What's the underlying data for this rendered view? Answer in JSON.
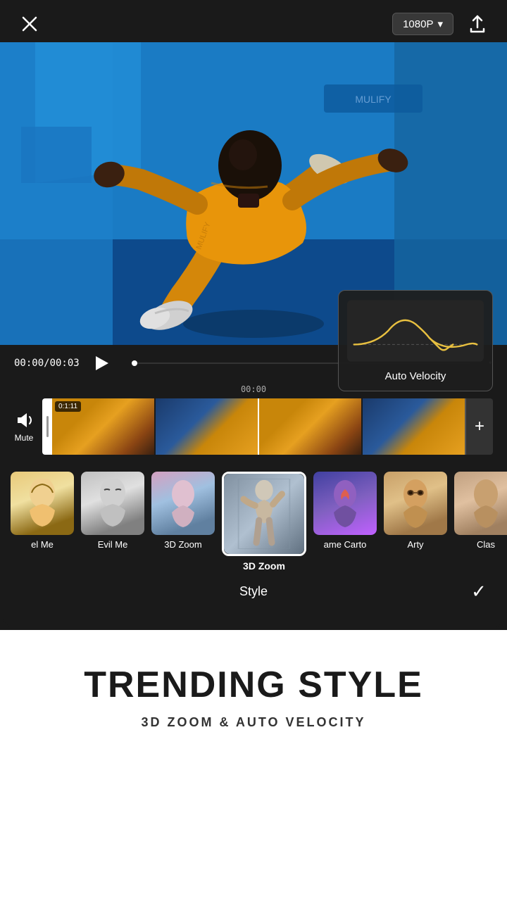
{
  "header": {
    "close_label": "×",
    "resolution": "1080P",
    "resolution_arrow": "▾",
    "export_icon": "upload"
  },
  "playback": {
    "current_time": "00:00",
    "total_time": "00:03",
    "time_display": "00:00/00:03",
    "timeline_time": "00:00"
  },
  "timeline": {
    "frame_badge": "0:1:11",
    "mute_label": "Mute"
  },
  "velocity_popup": {
    "label": "Auto Velocity"
  },
  "style_selector": {
    "items": [
      {
        "id": "el-me",
        "label": "el Me",
        "thumb_class": "thumb-anime1",
        "active": false
      },
      {
        "id": "evil-me",
        "label": "Evil Me",
        "thumb_class": "thumb-anime2",
        "active": false
      },
      {
        "id": "3d-zoom-inactive",
        "label": "3D Zoom",
        "thumb_class": "thumb-anime3",
        "active": false
      },
      {
        "id": "3d-zoom-active",
        "label": "3D Zoom",
        "thumb_class": "thumb-3dzoom",
        "active": true
      },
      {
        "id": "flame-carto",
        "label": "ame Carto",
        "thumb_class": "thumb-flame",
        "active": false
      },
      {
        "id": "arty",
        "label": "Arty",
        "thumb_class": "thumb-arty",
        "active": false
      },
      {
        "id": "classic",
        "label": "Clas",
        "thumb_class": "thumb-classic",
        "active": false
      }
    ],
    "bottom_label": "Style",
    "confirm_icon": "✓"
  },
  "bottom": {
    "title": "TRENDING STYLE",
    "subtitle": "3D ZOOM & AUTO VELOCITY"
  }
}
